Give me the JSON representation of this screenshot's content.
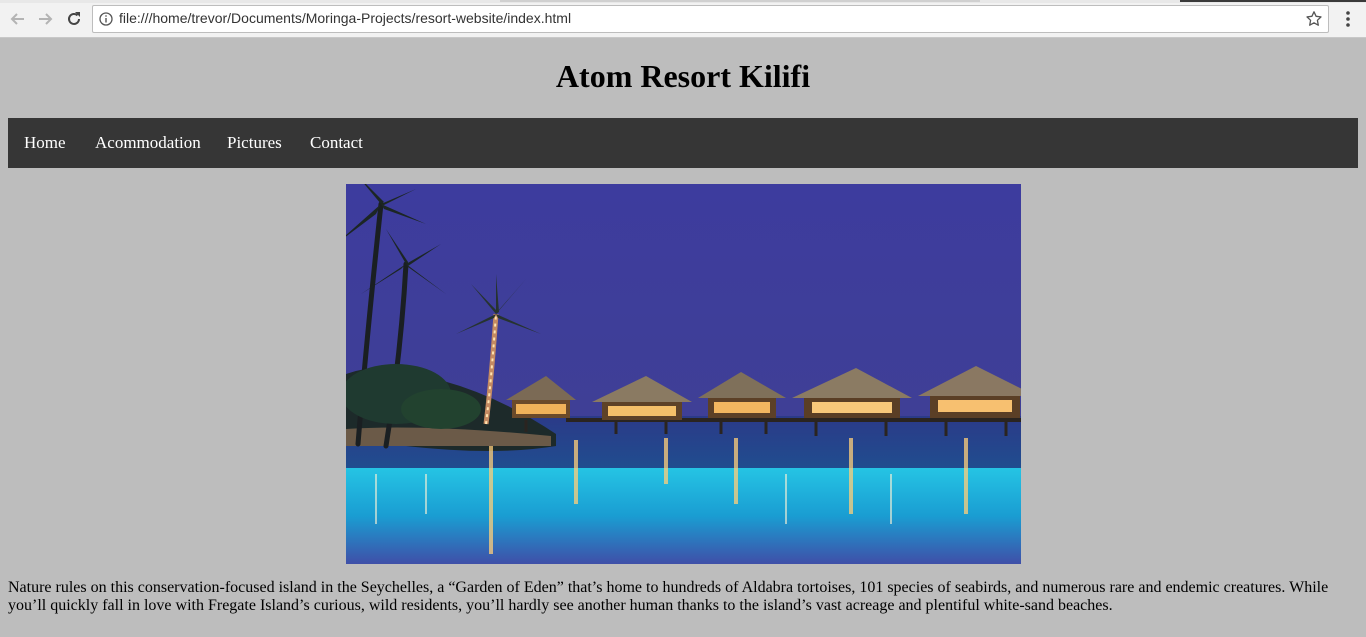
{
  "browser": {
    "url": "file:///home/trevor/Documents/Moringa-Projects/resort-website/index.html"
  },
  "site": {
    "title": "Atom Resort Kilifi",
    "nav": [
      "Home",
      "Acommodation",
      "Pictures",
      "Contact"
    ],
    "intro": "Nature rules on this conservation-focused island in the Seychelles, a “Garden of Eden” that’s home to hundreds of Aldabra tortoises, 101 species of seabirds, and numerous rare and endemic creatures. While you’ll quickly fall in love with Fregate Island’s curious, wild residents, you’ll hardly see another human thanks to the island’s vast acreage and plentiful white-sand beaches."
  },
  "colors": {
    "page_bg": "#bdbdbd",
    "nav_bg": "#363636",
    "sky": "#3e3f98",
    "pool": "#1fb4d8"
  }
}
